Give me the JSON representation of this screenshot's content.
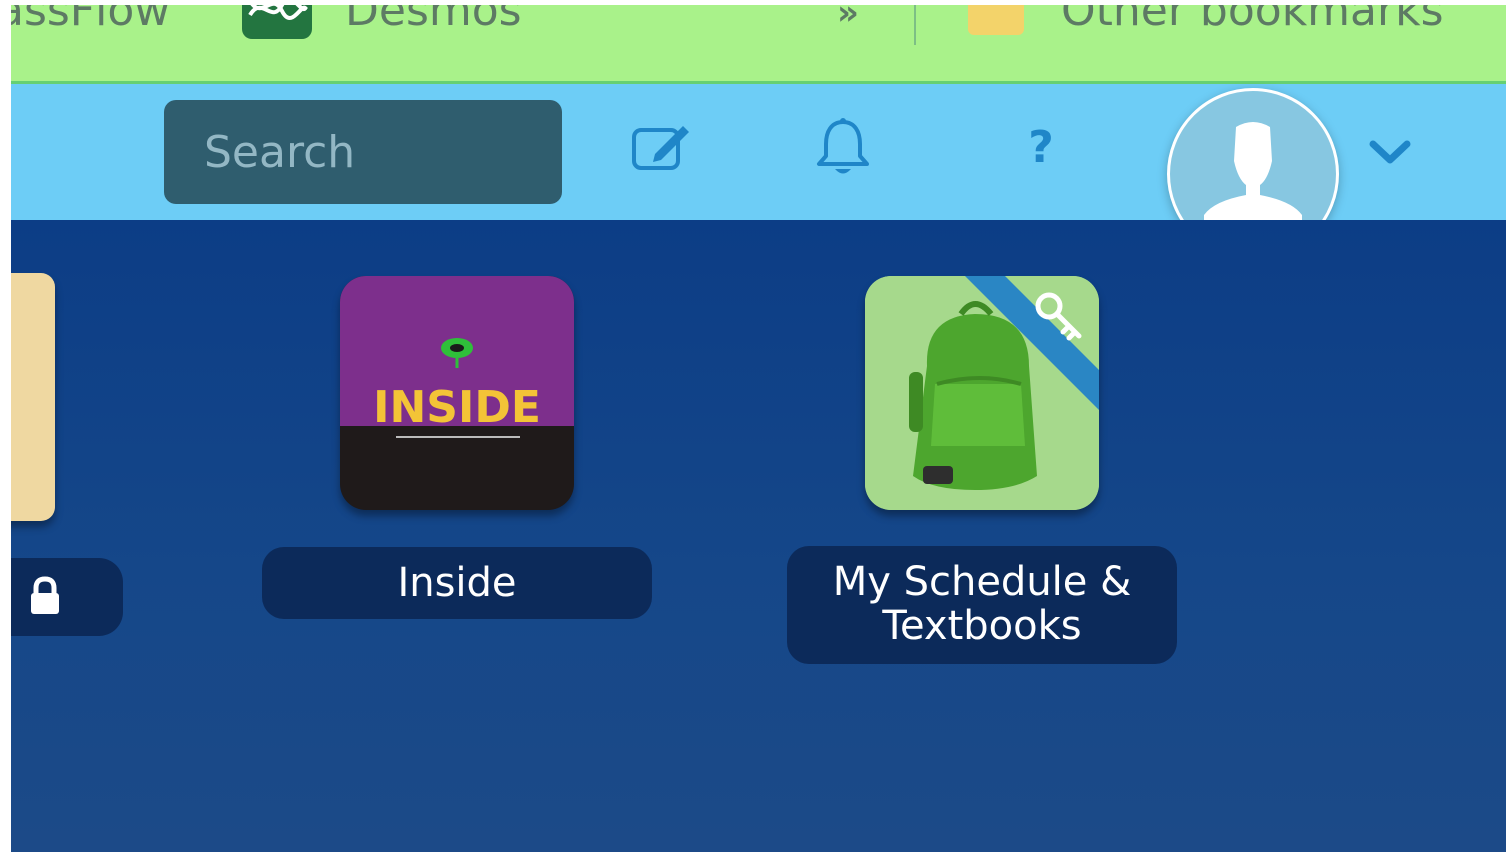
{
  "bookmarks_bar": {
    "items": [
      {
        "label": "assFlow",
        "icon": "classflow-icon"
      },
      {
        "label": "Desmos",
        "icon": "desmos-icon"
      }
    ],
    "overflow_label": "»",
    "other_bookmarks": {
      "label": "Other bookmarks",
      "icon": "folder-icon"
    }
  },
  "header": {
    "search": {
      "placeholder": "Search",
      "value": ""
    },
    "icons": [
      "edit-icon",
      "bell-icon",
      "help-icon",
      "chevron-down-icon"
    ],
    "help_label": "?",
    "avatar": "user-avatar-icon"
  },
  "apps": [
    {
      "label_line1": "",
      "label_line2": "",
      "icon": "lock-icon",
      "bg_color": "#efd8a1"
    },
    {
      "label_line1": "Inside",
      "icon_text": "INSIDE",
      "bg_color": "#7d2f8c"
    },
    {
      "label_line1": "My Schedule &",
      "label_line2": "Textbooks",
      "icon": "backpack-key-icon",
      "bg_color": "#a6d98c"
    }
  ],
  "colors": {
    "bookmarks_bg": "#a9f28a",
    "header_bg": "#6dcdf6",
    "main_bg": "#154789",
    "label_bg": "#0c2a5a",
    "accent": "#1f86c8"
  }
}
